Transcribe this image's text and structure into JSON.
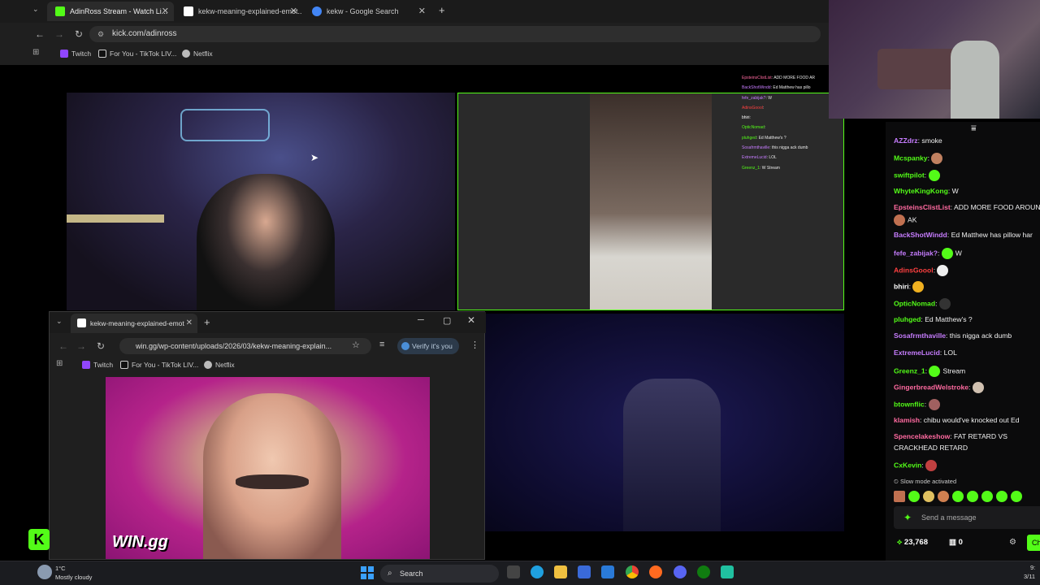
{
  "browser": {
    "tabs": [
      {
        "label": "AdinRoss Stream - Watch Li...",
        "favicon_color": "#53fc18"
      },
      {
        "label": "kekw-meaning-explained-emot...",
        "favicon_color": "#ffffff"
      },
      {
        "label": "kekw - Google Search",
        "favicon_color": "#4285f4"
      }
    ],
    "new_tab": "+",
    "url": "kick.com/adinross",
    "bookmarks": [
      {
        "label": "Twitch",
        "color": "#9146ff"
      },
      {
        "label": "For You - TikTok LIV...",
        "color": "#ffffff"
      },
      {
        "label": "Netflix",
        "color": "#bbbbbb"
      }
    ]
  },
  "overlay_chat": [
    {
      "user": "EpsteinsClistList",
      "text": "ADD MORE FOOD AR",
      "color": "#ff6aa0"
    },
    {
      "user": "BackShotWindd",
      "text": "Ed Matthew has pillo",
      "color": "#c77dff"
    },
    {
      "user": "fefe_zabijak?",
      "text": "W",
      "color": "#c77dff"
    },
    {
      "user": "AdinsGoool",
      "text": "",
      "color": "#ff4040"
    },
    {
      "user": "bhiri",
      "text": "",
      "color": "#ffffff"
    },
    {
      "user": "OpticNomad",
      "text": "",
      "color": "#53fc18"
    },
    {
      "user": "pluhged",
      "text": "Ed Matthew's ?",
      "color": "#53fc18"
    },
    {
      "user": "Sosafrmthaville",
      "text": "this nigga ack dumb",
      "color": "#c77dff"
    },
    {
      "user": "ExtremeLucid",
      "text": "LOL",
      "color": "#c77dff"
    },
    {
      "user": "Greenz_1",
      "text": "W Stream",
      "color": "#53fc18"
    }
  ],
  "second_window": {
    "tab_label": "kekw-meaning-explained-emot",
    "url": "win.gg/wp-content/uploads/2026/03/kekw-meaning-explain...",
    "verify_label": "Verify it's you",
    "bookmarks": [
      "Twitch",
      "For You - TikTok LIV...",
      "Netflix"
    ],
    "image_watermark": "WIN.gg"
  },
  "chat": {
    "messages": [
      {
        "user": "AZZdrz",
        "text": "smoke",
        "color": "#c77dff"
      },
      {
        "user": "Mcspanky",
        "text": "",
        "color": "#53fc18",
        "emote": "#c08060"
      },
      {
        "user": "swiftpilot",
        "text": "",
        "color": "#53fc18",
        "emote": "#53fc18"
      },
      {
        "user": "WhyteKingKong",
        "text": "W",
        "color": "#53fc18"
      },
      {
        "user": "EpsteinsClistList",
        "text": "ADD MORE FOOD AROUN",
        "color": "#ff6aa0"
      },
      {
        "user": "",
        "text": "AK",
        "color": "#ffffff",
        "emote": "#c07050"
      },
      {
        "user": "BackShotWindd",
        "text": "Ed Matthew has pillow har",
        "color": "#c77dff"
      },
      {
        "user": "fefe_zabijak?",
        "text": "W",
        "color": "#c77dff",
        "emote": "#53fc18"
      },
      {
        "user": "AdinsGoool",
        "text": "",
        "color": "#ff4040",
        "emote": "#eeeeee"
      },
      {
        "user": "bhiri",
        "text": "",
        "color": "#ffffff",
        "emote": "#f0b020"
      },
      {
        "user": "OpticNomad",
        "text": "",
        "color": "#53fc18",
        "emote": "#333333"
      },
      {
        "user": "pluhged",
        "text": "Ed Matthew's ?",
        "color": "#53fc18"
      },
      {
        "user": "Sosafrmthaville",
        "text": "this nigga ack dumb",
        "color": "#c77dff"
      },
      {
        "user": "ExtremeLucid",
        "text": "LOL",
        "color": "#c77dff"
      },
      {
        "user": "Greenz_1",
        "text": "Stream",
        "color": "#53fc18",
        "emote": "#53fc18"
      },
      {
        "user": "GingerbreadWelstroke",
        "text": "",
        "color": "#ff6aa0",
        "emote": "#d0c0b0"
      },
      {
        "user": "btownflic",
        "text": "",
        "color": "#53fc18",
        "emote": "#a06060"
      },
      {
        "user": "klamish",
        "text": "chibu would've knocked out Ed",
        "color": "#ff6aa0"
      },
      {
        "user": "Spencelakeshow",
        "text": "FAT RETARD VS",
        "color": "#ff6aa0"
      },
      {
        "user": "",
        "text": "CRACKHEAD RETARD",
        "color": "#ffffff"
      },
      {
        "user": "CxKevin",
        "text": "",
        "color": "#53fc18",
        "emote": "#c04040"
      }
    ],
    "slow_mode": "Slow mode activated",
    "send_placeholder": "Send a message",
    "viewers": "23,768",
    "gifts": "0",
    "chat_button": "Ch"
  },
  "taskbar": {
    "weather_temp": "1°C",
    "weather_desc": "Mostly cloudy",
    "search_label": "Search",
    "time": "9:",
    "date": "3/11"
  }
}
